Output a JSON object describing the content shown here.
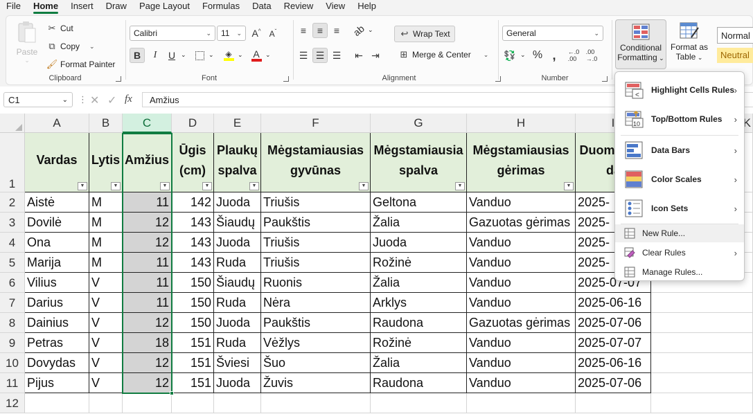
{
  "menu": [
    "File",
    "Home",
    "Insert",
    "Draw",
    "Page Layout",
    "Formulas",
    "Data",
    "Review",
    "View",
    "Help"
  ],
  "active_menu": "Home",
  "clipboard": {
    "paste": "Paste",
    "cut": "Cut",
    "copy": "Copy",
    "format_painter": "Format Painter",
    "label": "Clipboard"
  },
  "font": {
    "name": "Calibri",
    "size": "11",
    "label": "Font",
    "bold": "B",
    "italic": "I",
    "underline": "U",
    "font_color": "A"
  },
  "alignment": {
    "wrap_text": "Wrap Text",
    "merge_center": "Merge & Center",
    "label": "Alignment"
  },
  "number": {
    "format": "General",
    "label": "Number"
  },
  "styles": {
    "conditional_formatting_line1": "Conditional",
    "conditional_formatting_line2": "Formatting",
    "format_as_table_line1": "Format as",
    "format_as_table_line2": "Table",
    "normal": "Normal",
    "neutral": "Neutral"
  },
  "formula_bar": {
    "name_box": "C1",
    "content": "Amžius"
  },
  "columns": [
    "A",
    "B",
    "C",
    "D",
    "E",
    "F",
    "G",
    "H",
    "I",
    "K"
  ],
  "rows": [
    "1",
    "2",
    "3",
    "4",
    "5",
    "6",
    "7",
    "8",
    "9",
    "10",
    "11",
    "12"
  ],
  "table": {
    "headers": [
      "Vardas",
      "Lytis",
      "Amžius",
      "Ūgis (cm)",
      "Plaukų spalva",
      "Mėgstamiausias gyvūnas",
      "Mėgstamiausia spalva",
      "Mėgstamiausias gėrimas",
      "Duom pildy da"
    ],
    "rows": [
      [
        "Aistė",
        "M",
        "11",
        "142",
        "Juoda",
        "Triušis",
        "Geltona",
        "Vanduo",
        "2025-"
      ],
      [
        "Dovilė",
        "M",
        "12",
        "143",
        "Šiaudų",
        "Paukštis",
        "Žalia",
        "Gazuotas gėrimas",
        "2025-"
      ],
      [
        "Ona",
        "M",
        "12",
        "143",
        "Juoda",
        "Triušis",
        "Juoda",
        "Vanduo",
        "2025-"
      ],
      [
        "Marija",
        "M",
        "11",
        "143",
        "Ruda",
        "Triušis",
        "Rožinė",
        "Vanduo",
        "2025-"
      ],
      [
        "Vilius",
        "V",
        "11",
        "150",
        "Šiaudų",
        "Ruonis",
        "Žalia",
        "Vanduo",
        "2025-07-07"
      ],
      [
        "Darius",
        "V",
        "11",
        "150",
        "Ruda",
        "Nėra",
        "Arklys",
        "Vanduo",
        "2025-06-16"
      ],
      [
        "Dainius",
        "V",
        "12",
        "150",
        "Juoda",
        "Paukštis",
        "Raudona",
        "Gazuotas gėrimas",
        "2025-07-06"
      ],
      [
        "Petras",
        "V",
        "18",
        "151",
        "Ruda",
        "Vėžlys",
        "Rožinė",
        "Vanduo",
        "2025-07-07"
      ],
      [
        "Dovydas",
        "V",
        "12",
        "151",
        "Šviesi",
        "Šuo",
        "Žalia",
        "Vanduo",
        "2025-06-16"
      ],
      [
        "Pijus",
        "V",
        "12",
        "151",
        "Juoda",
        "Žuvis",
        "Raudona",
        "Vanduo",
        "2025-07-06"
      ]
    ]
  },
  "cf_menu": {
    "highlight_rules": "Highlight Cells Rules",
    "top_bottom_rules": "Top/Bottom Rules",
    "data_bars": "Data Bars",
    "color_scales": "Color Scales",
    "icon_sets": "Icon Sets",
    "new_rule": "New Rule...",
    "clear_rules": "Clear Rules",
    "manage_rules": "Manage Rules..."
  },
  "colors": {
    "accent": "#107c41",
    "header_fill": "#e2efda",
    "selected_col": "#d4d4d4",
    "neutral_fill": "#ffeb9c"
  }
}
